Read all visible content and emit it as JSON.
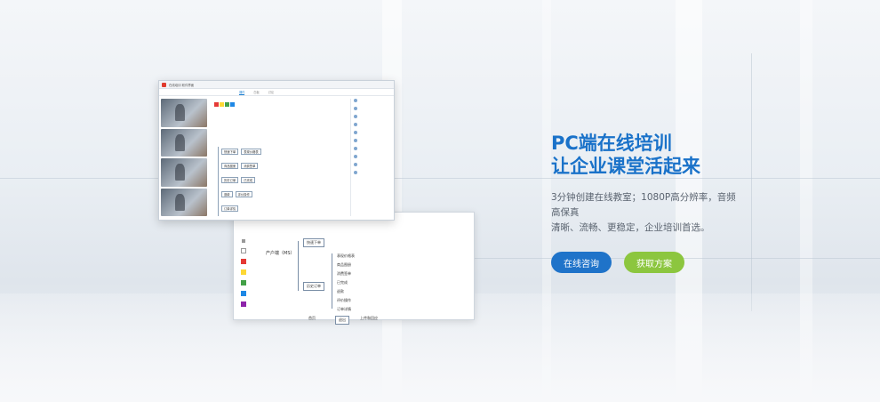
{
  "hero": {
    "title_line1": "PC端在线培训",
    "title_line2": "让企业课堂活起来",
    "desc_line1": "3分钟创建在线教室；1080P高分辨率，音频高保真",
    "desc_line2": "清晰、流畅、更稳定，企业培训首选。"
  },
  "buttons": {
    "consult_label": "在线咨询",
    "plan_label": "获取方案"
  },
  "app": {
    "title": "在线培训 软件界面",
    "tabs": [
      "课件",
      "白板",
      "讨论"
    ],
    "mind_root": "产户端（MS）",
    "mind_branches": [
      "快速下单",
      "历史订单",
      "首页"
    ],
    "mind_items": [
      "表现价格表",
      "商品图册",
      "消费签单",
      "已完成",
      "退款",
      "评价操作",
      "订单详情"
    ],
    "mind_bottom": [
      "退出",
      "上传和回应",
      "搜索"
    ]
  },
  "colors": {
    "accent_blue": "#1a72c9",
    "button_blue": "#1f73c9",
    "button_green": "#8cc63f"
  }
}
